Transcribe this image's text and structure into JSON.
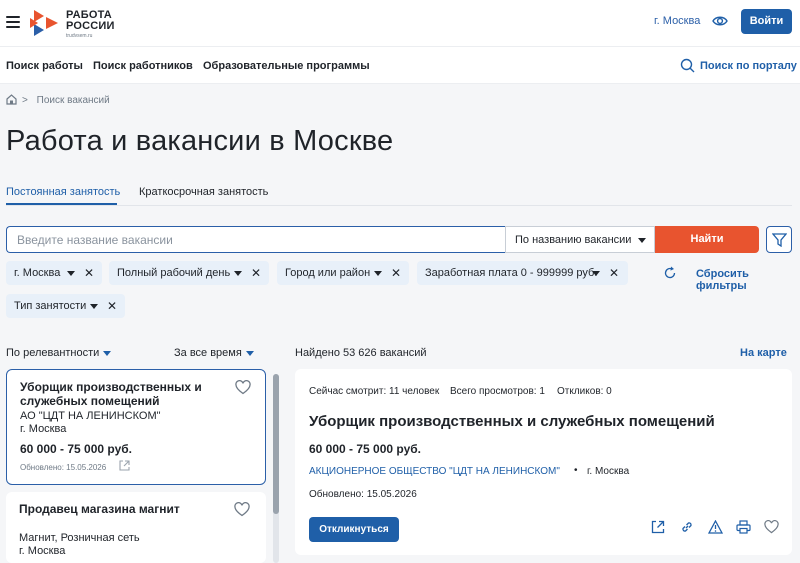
{
  "header": {
    "logo_text_line1": "РАБОТА",
    "logo_text_line2": "РОССИИ",
    "logo_url": "trudvsem.ru",
    "city": "г. Москва",
    "login_label": "Войти"
  },
  "nav": {
    "items": [
      "Поиск работы",
      "Поиск работников",
      "Образовательные программы"
    ],
    "search_label": "Поиск по порталу"
  },
  "breadcrumb": {
    "separator": ">",
    "current": "Поиск вакансий"
  },
  "page_title": "Работа и вакансии в Москве",
  "tabs": [
    {
      "label": "Постоянная занятость",
      "active": true
    },
    {
      "label": "Краткосрочная занятость",
      "active": false
    }
  ],
  "search": {
    "placeholder": "Введите название вакансии",
    "mode": "По названию вакансии",
    "find_label": "Найти"
  },
  "filters": [
    "г. Москва",
    "Полный рабочий день",
    "Город или район",
    "Заработная плата 0 - 999999 руб.",
    "Тип занятости"
  ],
  "reset_label": "Сбросить фильтры",
  "sort": {
    "relevance": "По релевантности",
    "period": "За все время"
  },
  "found_text": "Найдено 53 626 вакансий",
  "map_link": "На карте",
  "list": [
    {
      "title": "Уборщик производственных и служебных помещений",
      "company": "АО \"ЦДТ НА ЛЕНИНСКОМ\"",
      "city": "г. Москва",
      "salary": "60 000 - 75 000 руб.",
      "updated": "Обновлено: 15.05.2026"
    },
    {
      "title": "Продавец магазина магнит",
      "company": "Магнит, Розничная сеть",
      "city": "г. Москва"
    }
  ],
  "detail": {
    "viewing_now": "Сейчас смотрит: 11 человек",
    "total_views": "Всего просмотров: 1",
    "responses": "Откликов: 0",
    "title": "Уборщик производственных и служебных помещений",
    "salary": "60 000 - 75 000 руб.",
    "company": "АКЦИОНЕРНОЕ ОБЩЕСТВО \"ЦДТ НА ЛЕНИНСКОМ\"",
    "dot": "•",
    "city": "г. Москва",
    "updated": "Обновлено: 15.05.2026",
    "apply_label": "Откликнуться"
  },
  "colors": {
    "brand_blue": "#1f5fa8",
    "accent_orange": "#e8542f",
    "chip_bg": "#e8f0f9"
  },
  "icons": [
    "menu-icon",
    "eye-icon",
    "search-icon",
    "home-icon",
    "filter-icon",
    "reset-icon",
    "heart-icon",
    "external-link-icon",
    "link-icon",
    "warning-icon",
    "print-icon"
  ]
}
